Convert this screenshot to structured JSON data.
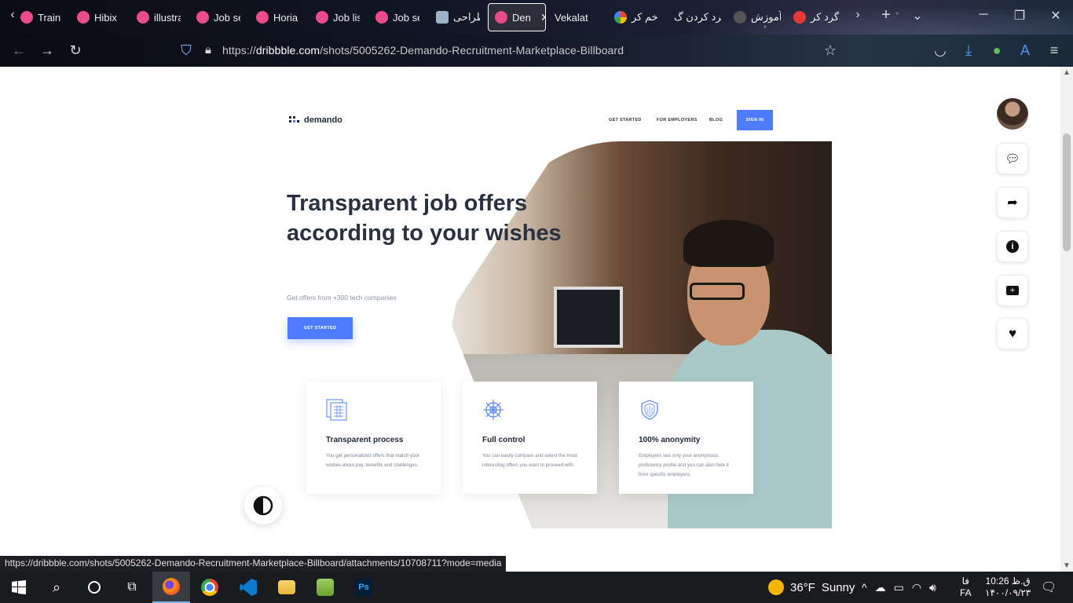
{
  "browser": {
    "tabs": [
      {
        "label": "Trainin"
      },
      {
        "label": "Hibix"
      },
      {
        "label": "illustra"
      },
      {
        "label": "Job se"
      },
      {
        "label": "Horia"
      },
      {
        "label": "Job lis"
      },
      {
        "label": "Job se"
      },
      {
        "label": "طراحی"
      },
      {
        "label": "Den"
      },
      {
        "label": "Vekalat"
      },
      {
        "label": "خم کر"
      },
      {
        "label": "گرد کردن گ"
      },
      {
        "label": "آموزش"
      },
      {
        "label": "گرد کر"
      }
    ],
    "url_prefix": "https://",
    "url_domain": "dribbble.com",
    "url_path": "/shots/5005262-Demando-Recruitment-Marketplace-Billboard",
    "status_url": "https://dribbble.com/shots/5005262-Demando-Recruitment-Marketplace-Billboard/attachments/10708711?mode=media"
  },
  "site": {
    "logo_text": "demando",
    "nav": [
      "GET STARTED",
      "FOR EMPLOYERS",
      "BLOG"
    ],
    "signin": "SIGN IN",
    "headline": "Transparent job offers according to your wishes",
    "subline": "Get offers from +300 tech companies",
    "cta": "GET STARTED",
    "cards": [
      {
        "title": "Transparent process",
        "text": "You get personalized offers that match your wishes about pay, benefits and challenges."
      },
      {
        "title": "Full control",
        "text": "You can easily compare and select the most interesting offers you want to proceed with."
      },
      {
        "title": "100% anonymity",
        "text": "Employers see only your anonymous proficiency profile and you can also hide it from specific employers."
      }
    ],
    "accent_color": "#4f7cff"
  },
  "taskbar": {
    "weather_temp": "36°F",
    "weather_text": "Sunny",
    "lang_top": "فا",
    "lang_bottom": "FA",
    "time": "10:26 ق.ظ",
    "date": "۱۴۰۰/۰۹/۲۳"
  }
}
